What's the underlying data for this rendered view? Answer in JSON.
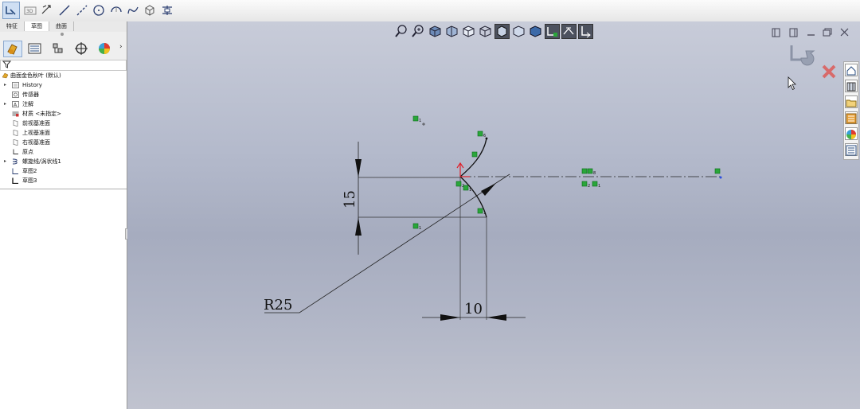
{
  "feature_manager": {
    "tabs": [
      {
        "label": "特征",
        "active": false
      },
      {
        "label": "草图",
        "active": true
      },
      {
        "label": "曲面",
        "active": false
      }
    ],
    "panel_icons": [
      {
        "name": "feature-manager-icon",
        "active": true
      },
      {
        "name": "property-manager-icon",
        "active": false
      },
      {
        "name": "configuration-manager-icon",
        "active": false
      },
      {
        "name": "dimxpert-icon",
        "active": false
      },
      {
        "name": "display-manager-icon",
        "active": false
      }
    ],
    "tree": [
      {
        "label": "曲面金色秋叶 (默认)",
        "icon": "part-icon",
        "expandable": false,
        "level": 0
      },
      {
        "label": "History",
        "icon": "history-icon",
        "expandable": true,
        "level": 1
      },
      {
        "label": "传感器",
        "icon": "sensor-icon",
        "expandable": false,
        "level": 1
      },
      {
        "label": "注解",
        "icon": "annotation-icon",
        "expandable": true,
        "level": 1
      },
      {
        "label": "材质 <未指定>",
        "icon": "material-icon",
        "expandable": false,
        "level": 1
      },
      {
        "label": "前视基准面",
        "icon": "plane-icon",
        "expandable": false,
        "level": 1
      },
      {
        "label": "上视基准面",
        "icon": "plane-icon",
        "expandable": false,
        "level": 1
      },
      {
        "label": "右视基准面",
        "icon": "plane-icon",
        "expandable": false,
        "level": 1
      },
      {
        "label": "原点",
        "icon": "origin-icon",
        "expandable": false,
        "level": 1
      },
      {
        "label": "螺旋线/涡状线1",
        "icon": "helix-icon",
        "expandable": true,
        "level": 1
      },
      {
        "label": "草图2",
        "icon": "sketch-icon",
        "expandable": false,
        "level": 1
      },
      {
        "label": "草图3",
        "icon": "sketch-icon",
        "expandable": false,
        "level": 1
      }
    ]
  },
  "sketch": {
    "dimensions": {
      "vertical": "15",
      "radius": "R25",
      "horizontal": "10"
    }
  },
  "colors": {
    "relation_marker": "#2aa63a",
    "origin_x": "#e0202a",
    "origin_y": "#2a4de0"
  }
}
